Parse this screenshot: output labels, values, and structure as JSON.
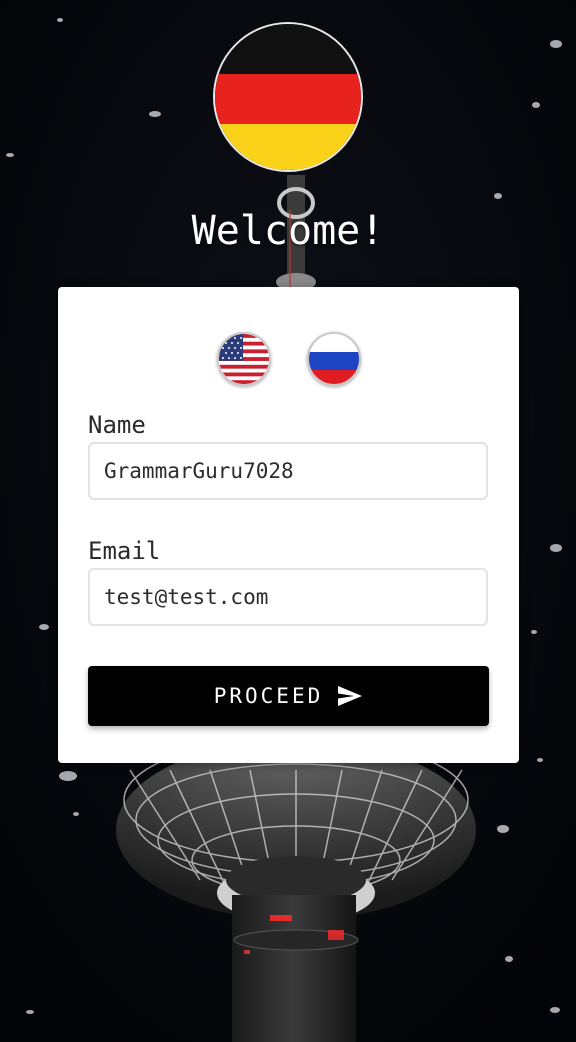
{
  "header": {
    "title": "Welcome!",
    "selected_language": "German",
    "selected_flag_icon": "germany-flag-icon"
  },
  "form": {
    "language_options": [
      {
        "language": "English",
        "icon": "usa-flag-icon"
      },
      {
        "language": "Russian",
        "icon": "russia-flag-icon"
      }
    ],
    "name_label": "Name",
    "name_value": "GrammarGuru7028",
    "email_label": "Email",
    "email_value": "test@test.com",
    "submit_label": "PROCEED",
    "submit_icon": "send-icon"
  },
  "colors": {
    "flag_de": [
      "#111111",
      "#e8231d",
      "#fbd21a"
    ],
    "flag_ru": [
      "#ffffff",
      "#1d44c2",
      "#e01d23"
    ],
    "button": "#000000",
    "background": "#05070c"
  }
}
